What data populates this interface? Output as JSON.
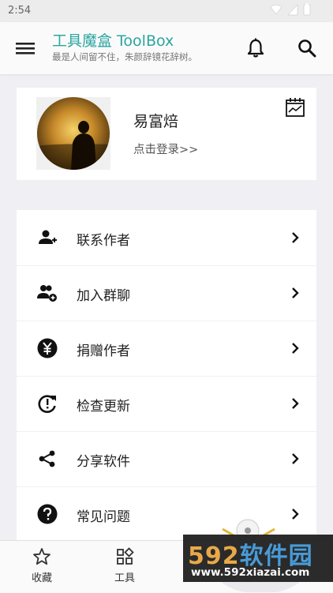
{
  "status": {
    "time": "2:54"
  },
  "appbar": {
    "title": "工具魔盒 ToolBox",
    "subtitle": "最是人间留不住，朱颜辞镜花辞树。"
  },
  "profile": {
    "name": "易富焙",
    "login": "点击登录>>"
  },
  "menu": {
    "items": [
      {
        "label": "联系作者",
        "icon": "add-person-icon"
      },
      {
        "label": "加入群聊",
        "icon": "group-add-icon"
      },
      {
        "label": "捐赠作者",
        "icon": "yuan-icon"
      },
      {
        "label": "检查更新",
        "icon": "update-icon"
      },
      {
        "label": "分享软件",
        "icon": "share-icon"
      },
      {
        "label": "常见问题",
        "icon": "help-icon"
      }
    ]
  },
  "bottomnav": {
    "tabs": [
      {
        "label": "收藏",
        "icon": "star-icon"
      },
      {
        "label": "工具",
        "icon": "apps-icon"
      }
    ]
  },
  "watermark": {
    "brand_num": "592",
    "brand_text": "软件园",
    "url": "www.592xiazai.com"
  },
  "colors": {
    "accent": "#2aa6a0",
    "background": "#efeff4"
  }
}
